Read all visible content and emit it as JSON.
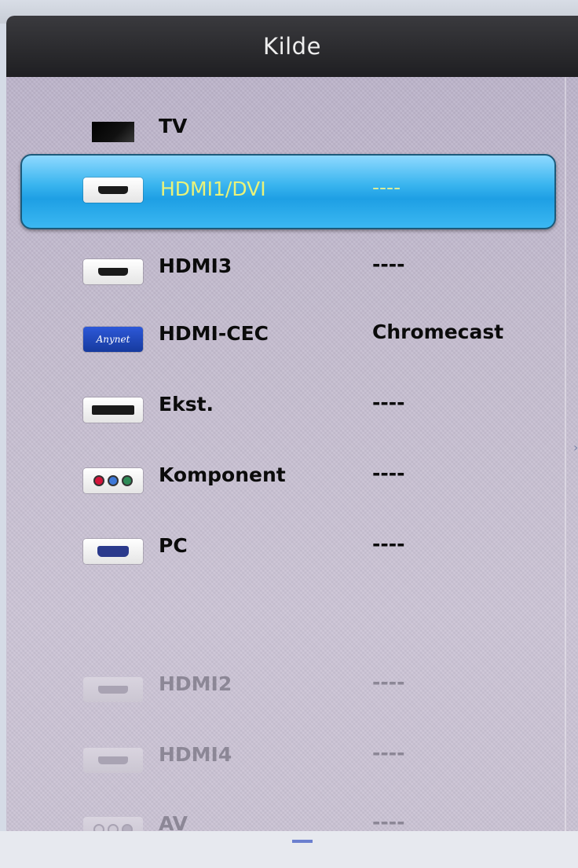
{
  "title": "Kilde",
  "sources": [
    {
      "name": "TV",
      "value": "",
      "icon": "tv-icon",
      "state": "normal"
    },
    {
      "name": "HDMI1/DVI",
      "value": "----",
      "icon": "hdmi-port-icon",
      "state": "selected"
    },
    {
      "name": "HDMI3",
      "value": "----",
      "icon": "hdmi-port-icon",
      "state": "normal"
    },
    {
      "name": "HDMI-CEC",
      "value": "Chromecast",
      "icon": "anynet-icon",
      "icon_text": "Anynet",
      "state": "normal"
    },
    {
      "name": "Ekst.",
      "value": "----",
      "icon": "scart-icon",
      "state": "normal"
    },
    {
      "name": "Komponent",
      "value": "----",
      "icon": "component-icon",
      "state": "normal"
    },
    {
      "name": "PC",
      "value": "----",
      "icon": "vga-icon",
      "state": "normal"
    },
    {
      "name": "HDMI2",
      "value": "----",
      "icon": "hdmi-port-icon",
      "state": "disabled"
    },
    {
      "name": "HDMI4",
      "value": "----",
      "icon": "hdmi-port-icon",
      "state": "disabled"
    },
    {
      "name": "AV",
      "value": "----",
      "icon": "av-icon",
      "state": "disabled"
    }
  ],
  "colors": {
    "selected_highlight": "#1e9fe4",
    "selected_text": "#e9f27a",
    "title_bar": "#1f1f22"
  }
}
